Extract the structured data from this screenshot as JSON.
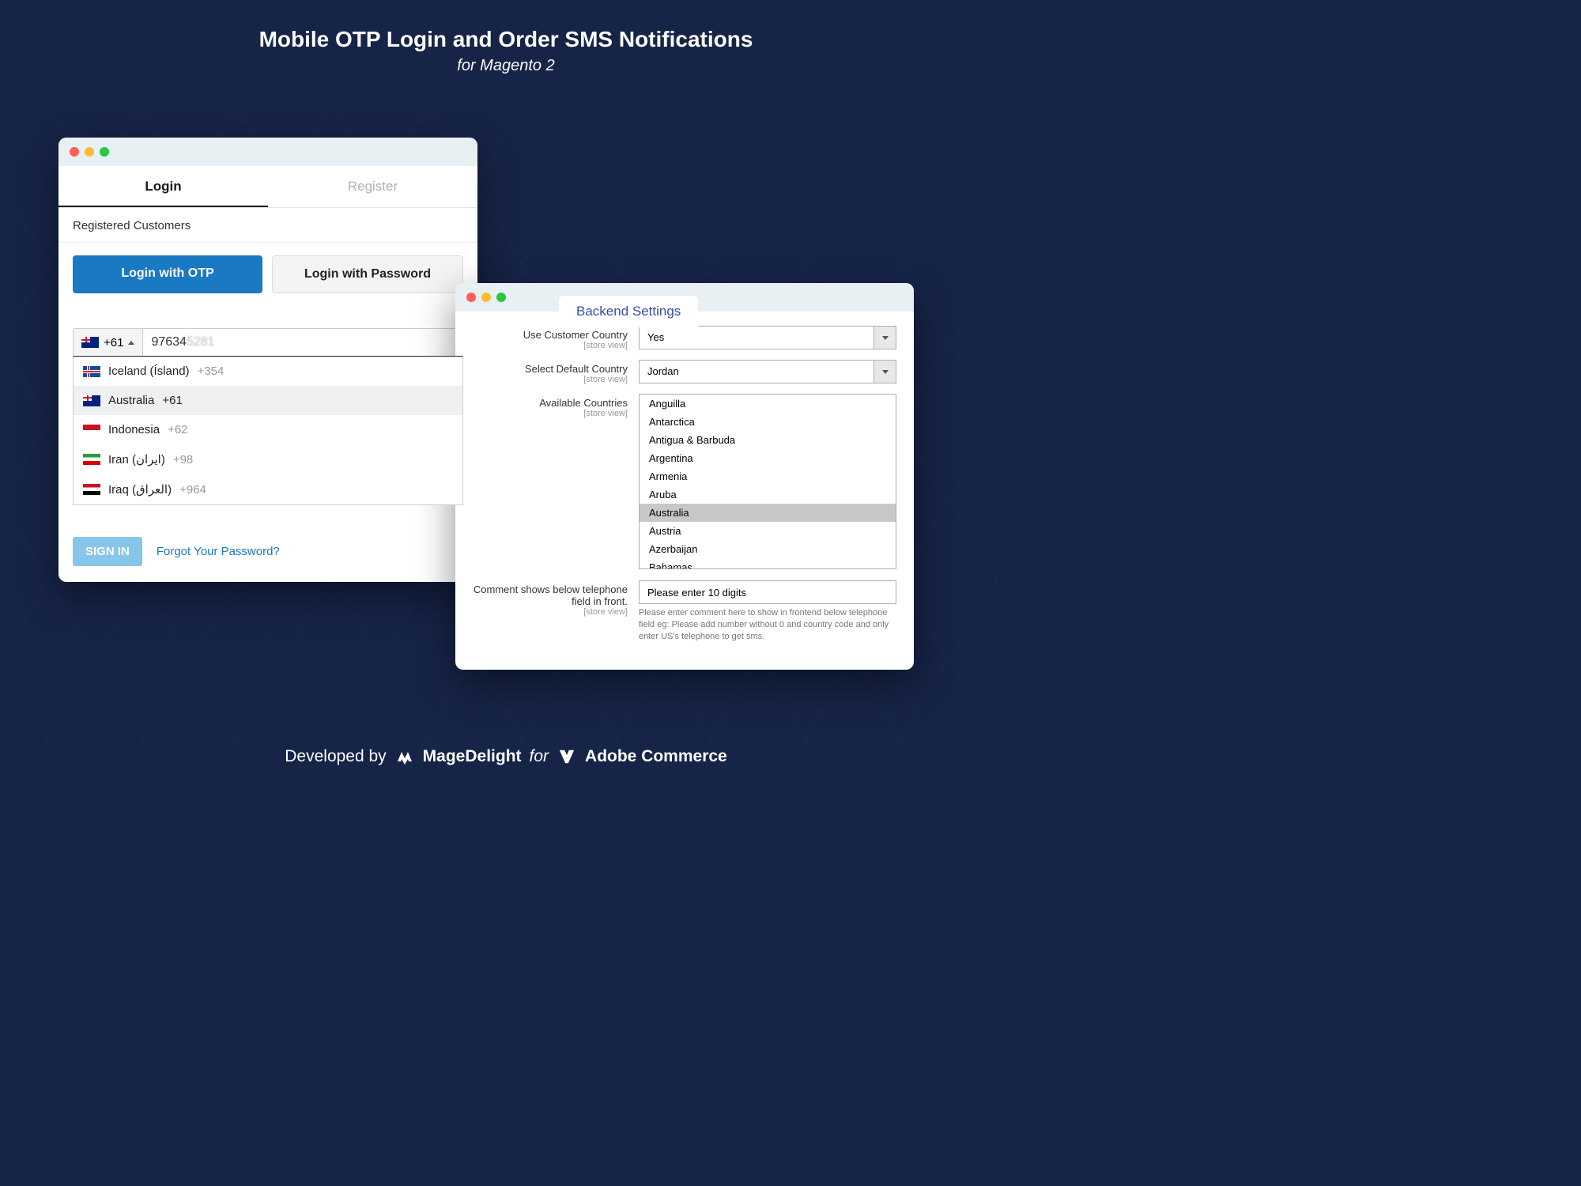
{
  "hero": {
    "title": "Mobile OTP Login and Order SMS Notifications",
    "subtitle": "for Magento 2"
  },
  "front": {
    "tabs": {
      "login": "Login",
      "register": "Register"
    },
    "section_label": "Registered Customers",
    "buttons": {
      "otp": "Login with OTP",
      "password": "Login with Password"
    },
    "phone": {
      "selected_code": "+61",
      "input_visible": "97634",
      "countries": [
        {
          "name": "Iceland (Ísland)",
          "code": "+354",
          "flag": "is"
        },
        {
          "name": "Australia",
          "code": "+61",
          "flag": "au",
          "selected": true
        },
        {
          "name": "Indonesia",
          "code": "+62",
          "flag": "id"
        },
        {
          "name": "Iran (ایران)",
          "code": "+98",
          "flag": "ir"
        },
        {
          "name": "Iraq (العراق)",
          "code": "+964",
          "flag": "iq"
        }
      ]
    },
    "sign_in": "SIGN IN",
    "forgot": "Forgot Your Password?"
  },
  "back": {
    "tab_title": "Backend Settings",
    "scope": "[store view]",
    "fields": {
      "use_customer_country": {
        "label": "Use Customer Country",
        "value": "Yes"
      },
      "select_default_country": {
        "label": "Select Default Country",
        "value": "Jordan"
      },
      "available_countries": {
        "label": "Available Countries",
        "options": [
          "Anguilla",
          "Antarctica",
          "Antigua & Barbuda",
          "Argentina",
          "Armenia",
          "Aruba",
          "Australia",
          "Austria",
          "Azerbaijan",
          "Bahamas"
        ],
        "selected": "Australia"
      },
      "comment": {
        "label": "Comment shows below telephone field in front.",
        "value": "Please enter 10 digits",
        "help": "Please enter comment here to show in frontend below telephone field eg: Please add number without 0 and country code and only enter US's telephone to get sms."
      }
    }
  },
  "footer": {
    "developed_by": "Developed by",
    "brand1": "MageDelight",
    "for": "for",
    "brand2": "Adobe Commerce"
  }
}
